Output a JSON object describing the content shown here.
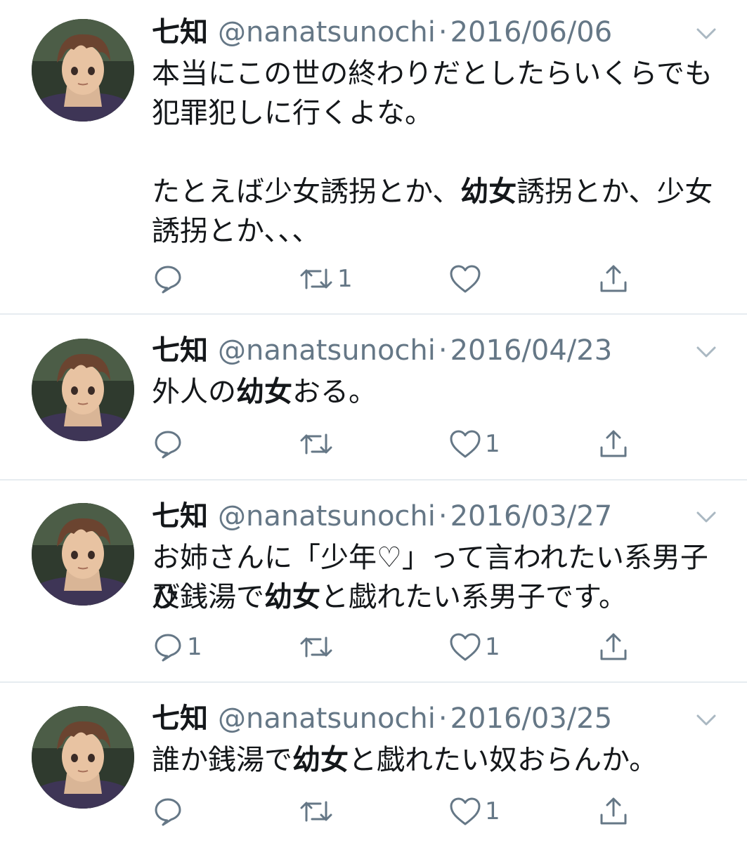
{
  "colors": {
    "text": "#14171a",
    "secondary": "#657786",
    "divider": "#e6ecf0"
  },
  "icons": {
    "reply": "reply-icon",
    "retweet": "retweet-icon",
    "like": "heart-icon",
    "share": "share-icon",
    "menu": "chevron-down-icon"
  },
  "tweets": [
    {
      "name": "七知",
      "handle": "@nanatsunochi",
      "dot": "·",
      "date": "2016/06/06",
      "lines": [
        [
          {
            "t": "本当にこの世の終わりだとしたらいくらでも"
          }
        ],
        [
          {
            "t": "犯罪犯しに行くよな。"
          }
        ],
        [
          {
            "t": ""
          }
        ],
        [
          {
            "t": "たとえば少女誘拐とか、"
          },
          {
            "t": "幼女",
            "b": true
          },
          {
            "t": "誘拐とか、少女"
          }
        ],
        [
          {
            "t": "誘拐とか、、、"
          }
        ]
      ],
      "reply_count": "",
      "retweet_count": "1",
      "like_count": "",
      "liked": false
    },
    {
      "name": "七知",
      "handle": "@nanatsunochi",
      "dot": "·",
      "date": "2016/04/23",
      "lines": [
        [
          {
            "t": "外人の"
          },
          {
            "t": "幼女",
            "b": true
          },
          {
            "t": "おる。"
          }
        ]
      ],
      "reply_count": "",
      "retweet_count": "",
      "like_count": "1"
    },
    {
      "name": "七知",
      "handle": "@nanatsunochi",
      "dot": "·",
      "date": "2016/03/27",
      "lines": [
        [
          {
            "t": "お姉さんに「少年♡」って言われたい系男子及"
          }
        ],
        [
          {
            "t": "び銭湯で"
          },
          {
            "t": "幼女",
            "b": true
          },
          {
            "t": "と戯れたい系男子です。"
          }
        ]
      ],
      "reply_count": "1",
      "retweet_count": "",
      "like_count": "1"
    },
    {
      "name": "七知",
      "handle": "@nanatsunochi",
      "dot": "·",
      "date": "2016/03/25",
      "lines": [
        [
          {
            "t": "誰か銭湯で"
          },
          {
            "t": "幼女",
            "b": true
          },
          {
            "t": "と戯れたい奴おらんか。"
          }
        ]
      ],
      "reply_count": "",
      "retweet_count": "",
      "like_count": "1"
    }
  ]
}
